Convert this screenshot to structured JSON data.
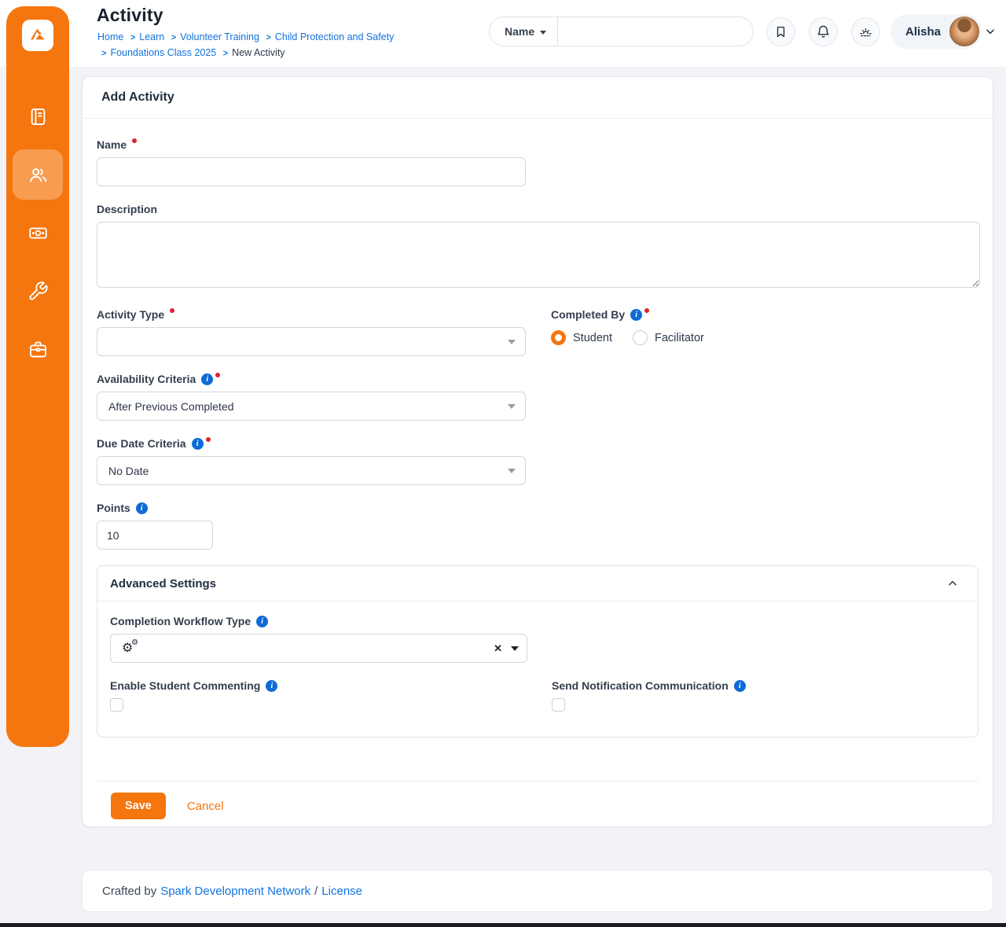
{
  "colors": {
    "accent_orange": "#f5760e",
    "link_blue": "#1273dd",
    "info_blue": "#0e6bd6",
    "required_red": "#dc2330",
    "page_background": "#f2f2f7"
  },
  "header": {
    "page_title": "Activity",
    "breadcrumbs": [
      "Home",
      "Learn",
      "Volunteer Training",
      "Child Protection and Safety",
      "Foundations Class 2025",
      "New Activity"
    ],
    "separator": ">",
    "search": {
      "scope_label": "Name",
      "query": ""
    },
    "user": {
      "name": "Alisha"
    }
  },
  "panel": {
    "title": "Add Activity",
    "fields": {
      "name": {
        "label": "Name",
        "value": ""
      },
      "description": {
        "label": "Description",
        "value": ""
      },
      "activity_type": {
        "label": "Activity Type",
        "value": ""
      },
      "completed_by": {
        "label": "Completed By",
        "options": [
          "Student",
          "Facilitator"
        ],
        "selected": "Student"
      },
      "availability_criteria": {
        "label": "Availability Criteria",
        "value": "After Previous Completed"
      },
      "due_date_criteria": {
        "label": "Due Date Criteria",
        "value": "No Date"
      },
      "points": {
        "label": "Points",
        "value": "10"
      }
    },
    "advanced": {
      "title": "Advanced Settings",
      "completion_workflow_type": {
        "label": "Completion Workflow Type",
        "value": ""
      },
      "enable_student_commenting": {
        "label": "Enable Student Commenting",
        "checked": false
      },
      "send_notification_communication": {
        "label": "Send Notification Communication",
        "checked": false
      }
    },
    "actions": {
      "save": "Save",
      "cancel": "Cancel"
    }
  },
  "footer": {
    "prefix": "Crafted by",
    "network_link": "Spark Development Network",
    "separator": "/",
    "license_link": "License"
  }
}
